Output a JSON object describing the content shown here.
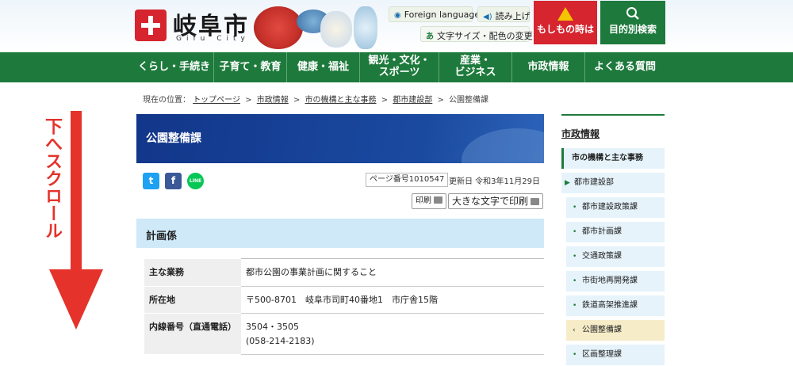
{
  "header": {
    "logo_name": "岐阜市",
    "logo_sub": "Gifu City",
    "foreign_language": "Foreign language",
    "read_aloud": "読み上げ",
    "font_size_color": "文字サイズ・配色の変更",
    "emergency": "もしもの時は",
    "search_by_purpose": "目的別検索"
  },
  "nav": {
    "items": [
      "くらし・手続き",
      "子育て・教育",
      "健康・福祉",
      "観光・文化・\nスポーツ",
      "産業・\nビジネス",
      "市政情報",
      "よくある質問"
    ]
  },
  "breadcrumb": {
    "label": "現在の位置：",
    "items": [
      "トップページ",
      "市政情報",
      "市の機構と主な事務",
      "都市建設部"
    ],
    "current": "公園整備課",
    "separator": ">"
  },
  "annotation": {
    "scroll_text": "下へスクロール"
  },
  "page": {
    "title": "公園整備課",
    "page_number": "ページ番号1010547",
    "updated": "更新日 令和3年11月29日",
    "print": "印刷",
    "print_large": "大きな文字で印刷",
    "section_title": "計画係"
  },
  "social": {
    "twitter": "t",
    "facebook": "f",
    "line": "LINE"
  },
  "info_table": {
    "rows": [
      {
        "label": "主な業務",
        "value": "都市公園の事業計画に関すること"
      },
      {
        "label": "所在地",
        "value": "〒500-8701　岐阜市司町40番地1　市庁舎15階"
      },
      {
        "label": "内線番号（直通電話）",
        "value": "3504・3505",
        "value2": "(058-214-2183)"
      }
    ]
  },
  "sidebar": {
    "title": "市政情報",
    "items": [
      "市の機構と主な事務",
      "都市建設部",
      "都市建設政策課",
      "都市計画課",
      "交通政策課",
      "市街地再開発課",
      "鉄道高架推進課",
      "公園整備課",
      "区画整理課"
    ]
  },
  "colors": {
    "brand_green": "#1e7a3c",
    "emergency_red": "#d6252f",
    "title_navy": "#12368a",
    "section_blue": "#cfe9f8",
    "arrow_red": "#e5322b"
  }
}
